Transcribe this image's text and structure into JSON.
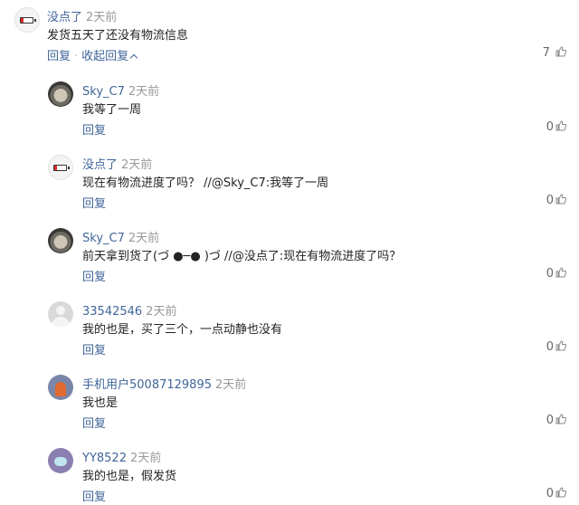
{
  "comment": {
    "username": "没点了",
    "time": "2天前",
    "text": "发货五天了还没有物流信息",
    "reply_label": "回复",
    "separator": "·",
    "collapse_label": "收起回复",
    "likes": "7"
  },
  "replies": [
    {
      "username": "Sky_C7",
      "time": "2天前",
      "text": "我等了一周",
      "reply_label": "回复",
      "likes": "0",
      "avatar": "sky"
    },
    {
      "username": "没点了",
      "time": "2天前",
      "text": "现在有物流进度了吗？ //@Sky_C7:我等了一周",
      "reply_label": "回复",
      "likes": "0",
      "avatar": "battery"
    },
    {
      "username": "Sky_C7",
      "time": "2天前",
      "text": "前天拿到货了(づ ●─● )づ //@没点了:现在有物流进度了吗？",
      "reply_label": "回复",
      "likes": "0",
      "avatar": "sky"
    },
    {
      "username": "33542546",
      "time": "2天前",
      "text": "我的也是，买了三个，一点动静也没有",
      "reply_label": "回复",
      "likes": "0",
      "avatar": "gray"
    },
    {
      "username": "手机用户50087129895",
      "time": "2天前",
      "text": "我也是",
      "reply_label": "回复",
      "likes": "0",
      "avatar": "robot1"
    },
    {
      "username": "YY8522",
      "time": "2天前",
      "text": "我的也是，假发货",
      "reply_label": "回复",
      "likes": "0",
      "avatar": "robot2"
    }
  ]
}
